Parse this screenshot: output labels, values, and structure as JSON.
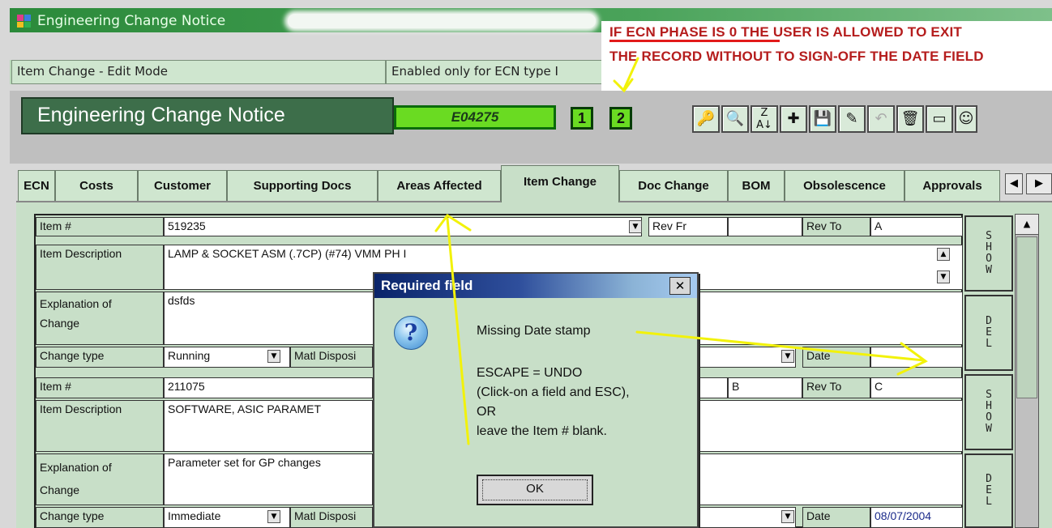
{
  "window": {
    "title": "Engineering Change Notice",
    "status_left": "Item Change - Edit Mode",
    "status_right": "Enabled only for ECN type I"
  },
  "annotation": {
    "line1": "IF ECN PHASE IS 0 THE USER IS ALLOWED TO EXIT",
    "line2": "THE RECORD WITHOUT TO SIGN-OFF THE DATE FIELD"
  },
  "header": {
    "title": "Engineering Change Notice",
    "ecn_number": "E04275",
    "phase1": "1",
    "phase2": "2",
    "toolbar_icons": [
      "key-icon",
      "binoculars-icon",
      "sort-az-icon",
      "add-record-icon",
      "save-edit-icon",
      "edit-pencil-icon",
      "undo-icon",
      "trash-icon",
      "window-icon",
      "smiley-icon"
    ]
  },
  "tabs": [
    "ECN",
    "Costs",
    "Customer",
    "Supporting Docs",
    "Areas Affected",
    "Item Change",
    "Doc Change",
    "BOM",
    "Obsolescence",
    "Approvals"
  ],
  "active_tab": "Item Change",
  "labels": {
    "item_num": "Item #",
    "item_desc": "Item Description",
    "explanation": "Explanation of",
    "explanation2": "Change",
    "change_type": "Change type",
    "matl_dispo": "Matl Disposi",
    "rev_fr": "Rev Fr",
    "rev_to": "Rev To",
    "date": "Date",
    "show": "SHOW",
    "del": "DEL"
  },
  "records": [
    {
      "item_num": "519235",
      "rev_fr": "",
      "rev_to": "A",
      "description": "LAMP & SOCKET ASM (.7CP) (#74) VMM PH I",
      "explanation": "dsfds",
      "change_type": "Running",
      "date": ""
    },
    {
      "item_num": "211075",
      "rev_fr": "B",
      "rev_to": "C",
      "description": "SOFTWARE, ASIC PARAMET",
      "explanation": "Parameter set for GP changes",
      "change_type": "Immediate",
      "date": "08/07/2004"
    }
  ],
  "dialog": {
    "title": "Required field",
    "line1": "Missing Date stamp",
    "line2": "ESCAPE = UNDO",
    "line3": "(Click-on a field and ESC),",
    "line4": "OR",
    "line5": "leave the Item # blank.",
    "ok": "OK"
  }
}
